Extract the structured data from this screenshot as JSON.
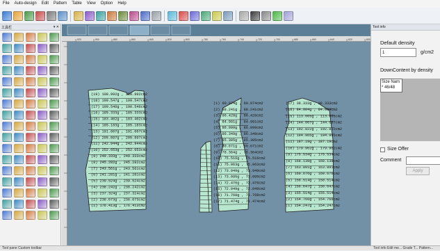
{
  "menu": [
    "File",
    "Auto-design",
    "Edit",
    "Pattern",
    "Table",
    "View",
    "Option",
    "Help"
  ],
  "left_panel": {
    "title": "工具栏",
    "controls": "▾ ✕"
  },
  "right_panel": {
    "tab_title": "Tool info",
    "default_density_label": "Default density",
    "density_value": "1",
    "density_unit": "g/cm2",
    "downcontent_label": "DownContent by density",
    "size_header": "Size Nam",
    "size_row": "46/48",
    "size_offer_label": "Size Offer",
    "comment_label": "Comment",
    "apply_label": "Apply"
  },
  "status": {
    "left_tabs": "Tool pane  Custom toolbar",
    "right_tabs": "Tool info  Edit me...  Grade T...  Pattern..."
  },
  "ruler": {
    "ticks": [
      "-920",
      "-900",
      "-880",
      "-860",
      "-840",
      "-820",
      "-800",
      "-780",
      "-760",
      "-740",
      "-720",
      "-700",
      "-680",
      "-660",
      "-640",
      "-620",
      "-600"
    ]
  },
  "pieces": {
    "p1": [
      "(19) 108.992g , 108.992cm2",
      "(18) 199.547g , 199.547cm2",
      "(17) 190.546g , 190.546cm2",
      "(16) 185.333g , 185.333cm2",
      "(15) 183.402g , 183.402cm2",
      "(14) 185.183g , 185.183cm2",
      "(13) 191.667g , 191.667cm2",
      "(12) 205.897g , 205.897cm2",
      "(11) 242.944g , 242.944cm2",
      "(10) 252.653g , 252.653cm2",
      "(9) 249.333g , 249.333cm2",
      "(8) 245.282g , 245.282cm2",
      "(7) 243.561g , 243.561cm2",
      "(6) 241.281g , 241.281cm2",
      "(5) 239.524g , 239.524cm2",
      "(4) 238.242g , 238.242cm2",
      "(3) 237.324g , 237.324cm2",
      "(2) 236.673g , 236.673cm2",
      "(1) 176.413g , 176.413cm2"
    ],
    "p3": [
      "(1) 60.974g , 60.974cm2",
      "(2) 88.241g , 88.241cm2",
      "(3) 96.428g , 86.428cm2",
      "(4) 84.991g , 84.991cm2",
      "(5) 86.099g , 86.099cm2",
      "(6) 86.349g , 86.349cm2",
      "(7) 85.385g , 85.385cm2",
      "(8) 80.671g , 80.671cm2",
      "(9) 78.364g , 78.364cm2",
      "(10) 75.516g , 75.516cm2",
      "(11) 75.063g , 75.063cm2",
      "(12) 73.949g , 73.949cm2",
      "(13) 73.095g , 73.095cm2",
      "(14) 72.476g , 72.476cm2",
      "(15) 72.049g , 72.049cm2",
      "(16) 71.768g , 71.768cm2",
      "(17) 71.474g , 71.474cm2"
    ],
    "p4": [
      "(17) 38.333g , 38.333cm2",
      "(16) 84.904g , 84.904cm2",
      "(15) 113.005g , 113.005cm2",
      "(14) 144.067g , 144.067cm2",
      "(13) 192.822g , 192.822cm2",
      "(12) 194.965g , 194.965cm2",
      "(11) 187.19g , 187.19cm2",
      "(10) 179.962g , 179.962cm2",
      "(9) 175.534g , 175.534cm2",
      "(8) 168.138g , 168.138cm2",
      "(7) 163.891g , 163.891cm2",
      "(6) 160.676g , 160.676cm2",
      "(5) 158.514g , 158.514cm2",
      "(4) 156.647g , 156.647cm2",
      "(3) 155.514g , 155.514cm2",
      "(2) 154.766g , 154.766cm2",
      "(1) 154.247g , 154.247cm2"
    ]
  },
  "colors": {
    "canvas": "#7391a6",
    "piece_fill": "#b8e6cf",
    "piece_line": "#1a1a1a"
  }
}
